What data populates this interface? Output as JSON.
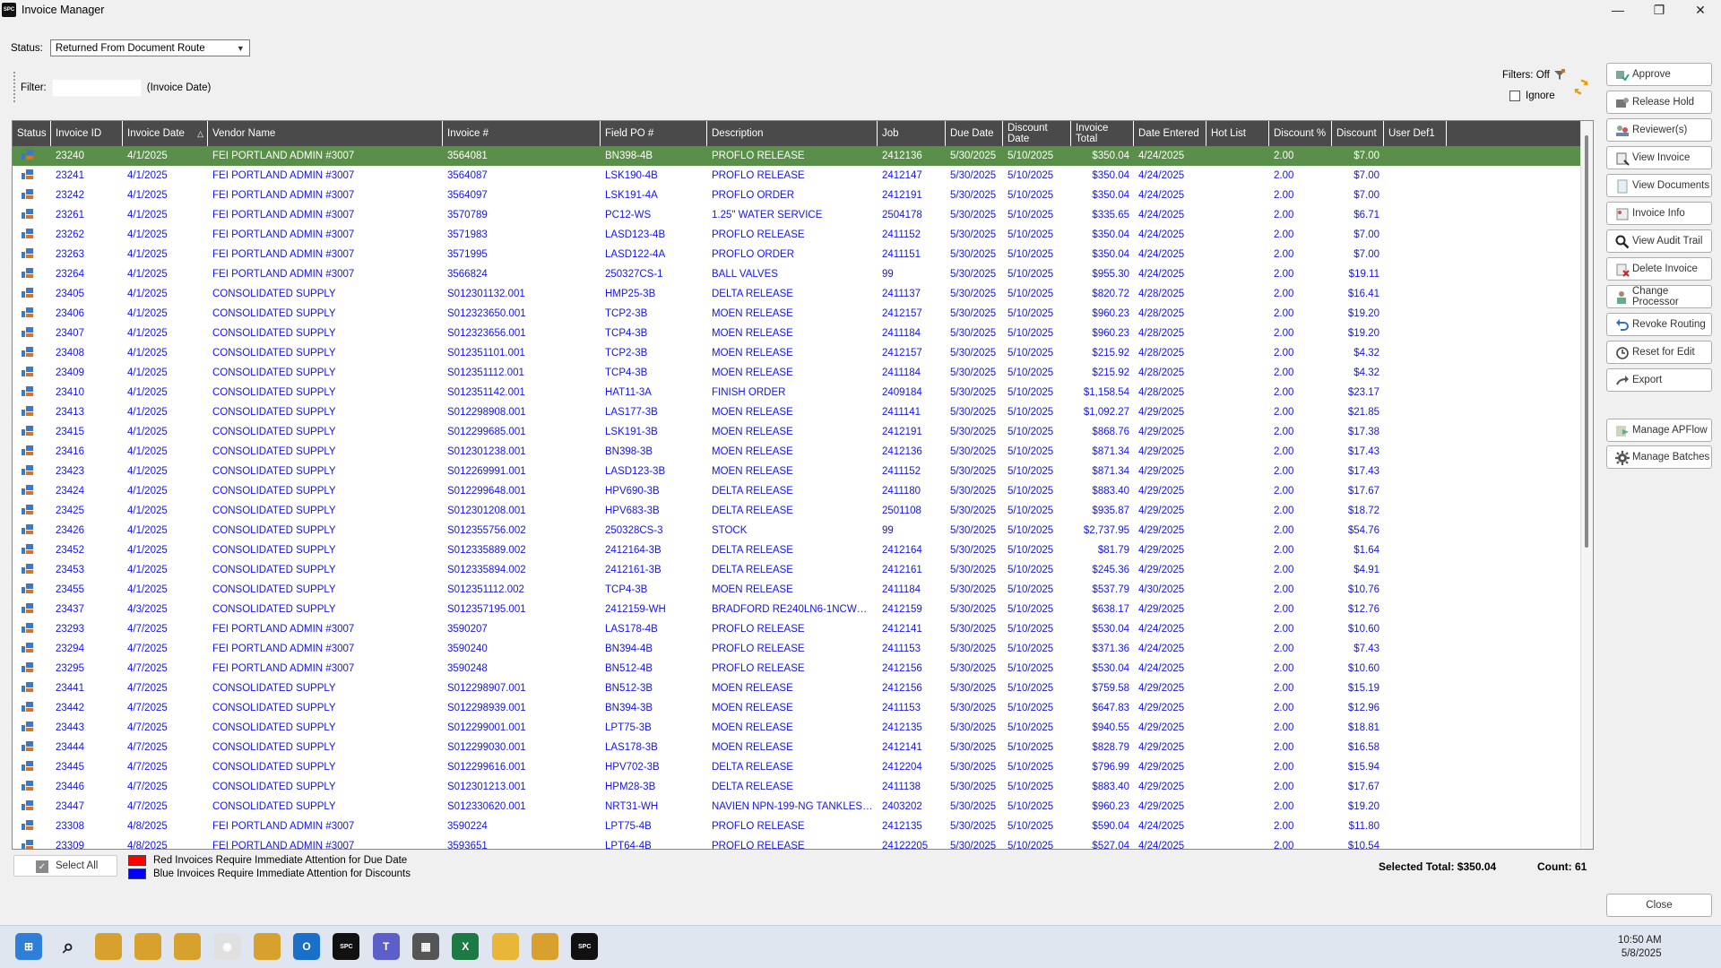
{
  "window": {
    "title": "Invoice Manager",
    "icon_text": "SPC",
    "controls": {
      "minimize": "—",
      "restore": "❐",
      "close": "✕"
    }
  },
  "toolbar": {
    "status_label": "Status:",
    "status_value": "Returned From Document Route",
    "filter_label": "Filter:",
    "filter_value": "",
    "filter_hint": "(Invoice Date)",
    "filters_off_label": "Filters: Off",
    "ignore_label": "Ignore"
  },
  "table": {
    "columns": [
      "Status",
      "Invoice ID",
      "Invoice Date",
      "Vendor Name",
      "Invoice #",
      "Field PO #",
      "Description",
      "Job",
      "Due Date",
      "Discount Date",
      "Invoice Total",
      "Date Entered",
      "Hot List",
      "Discount %",
      "Discount",
      "User Def1"
    ],
    "rows": [
      [
        "23240",
        "4/1/2025",
        "FEI PORTLAND ADMIN #3007",
        "3564081",
        "BN398-4B",
        "PROFLO RELEASE",
        "2412136",
        "5/30/2025",
        "5/10/2025",
        "$350.04",
        "4/24/2025",
        "",
        "2.00",
        "$7.00",
        ""
      ],
      [
        "23241",
        "4/1/2025",
        "FEI PORTLAND ADMIN #3007",
        "3564087",
        "LSK190-4B",
        "PROFLO RELEASE",
        "2412147",
        "5/30/2025",
        "5/10/2025",
        "$350.04",
        "4/24/2025",
        "",
        "2.00",
        "$7.00",
        ""
      ],
      [
        "23242",
        "4/1/2025",
        "FEI PORTLAND ADMIN #3007",
        "3564097",
        "LSK191-4A",
        "PROFLO ORDER",
        "2412191",
        "5/30/2025",
        "5/10/2025",
        "$350.04",
        "4/24/2025",
        "",
        "2.00",
        "$7.00",
        ""
      ],
      [
        "23261",
        "4/1/2025",
        "FEI PORTLAND ADMIN #3007",
        "3570789",
        "PC12-WS",
        "1.25\" WATER SERVICE",
        "2504178",
        "5/30/2025",
        "5/10/2025",
        "$335.65",
        "4/24/2025",
        "",
        "2.00",
        "$6.71",
        ""
      ],
      [
        "23262",
        "4/1/2025",
        "FEI PORTLAND ADMIN #3007",
        "3571983",
        "LASD123-4B",
        "PROFLO RELEASE",
        "2411152",
        "5/30/2025",
        "5/10/2025",
        "$350.04",
        "4/24/2025",
        "",
        "2.00",
        "$7.00",
        ""
      ],
      [
        "23263",
        "4/1/2025",
        "FEI PORTLAND ADMIN #3007",
        "3571995",
        "LASD122-4A",
        "PROFLO ORDER",
        "2411151",
        "5/30/2025",
        "5/10/2025",
        "$350.04",
        "4/24/2025",
        "",
        "2.00",
        "$7.00",
        ""
      ],
      [
        "23264",
        "4/1/2025",
        "FEI PORTLAND ADMIN #3007",
        "3566824",
        "250327CS-1",
        "BALL VALVES",
        "99",
        "5/30/2025",
        "5/10/2025",
        "$955.30",
        "4/24/2025",
        "",
        "2.00",
        "$19.11",
        ""
      ],
      [
        "23405",
        "4/1/2025",
        "CONSOLIDATED SUPPLY",
        "S012301132.001",
        "HMP25-3B",
        "DELTA RELEASE",
        "2411137",
        "5/30/2025",
        "5/10/2025",
        "$820.72",
        "4/28/2025",
        "",
        "2.00",
        "$16.41",
        ""
      ],
      [
        "23406",
        "4/1/2025",
        "CONSOLIDATED SUPPLY",
        "S012323650.001",
        "TCP2-3B",
        "MOEN RELEASE",
        "2412157",
        "5/30/2025",
        "5/10/2025",
        "$960.23",
        "4/28/2025",
        "",
        "2.00",
        "$19.20",
        ""
      ],
      [
        "23407",
        "4/1/2025",
        "CONSOLIDATED SUPPLY",
        "S012323656.001",
        "TCP4-3B",
        "MOEN RELEASE",
        "2411184",
        "5/30/2025",
        "5/10/2025",
        "$960.23",
        "4/28/2025",
        "",
        "2.00",
        "$19.20",
        ""
      ],
      [
        "23408",
        "4/1/2025",
        "CONSOLIDATED SUPPLY",
        "S012351101.001",
        "TCP2-3B",
        "MOEN RELEASE",
        "2412157",
        "5/30/2025",
        "5/10/2025",
        "$215.92",
        "4/28/2025",
        "",
        "2.00",
        "$4.32",
        ""
      ],
      [
        "23409",
        "4/1/2025",
        "CONSOLIDATED SUPPLY",
        "S012351112.001",
        "TCP4-3B",
        "MOEN RELEASE",
        "2411184",
        "5/30/2025",
        "5/10/2025",
        "$215.92",
        "4/28/2025",
        "",
        "2.00",
        "$4.32",
        ""
      ],
      [
        "23410",
        "4/1/2025",
        "CONSOLIDATED SUPPLY",
        "S012351142.001",
        "HAT11-3A",
        "FINISH ORDER",
        "2409184",
        "5/30/2025",
        "5/10/2025",
        "$1,158.54",
        "4/28/2025",
        "",
        "2.00",
        "$23.17",
        ""
      ],
      [
        "23413",
        "4/1/2025",
        "CONSOLIDATED SUPPLY",
        "S012298908.001",
        "LAS177-3B",
        "MOEN RELEASE",
        "2411141",
        "5/30/2025",
        "5/10/2025",
        "$1,092.27",
        "4/29/2025",
        "",
        "2.00",
        "$21.85",
        ""
      ],
      [
        "23415",
        "4/1/2025",
        "CONSOLIDATED SUPPLY",
        "S012299685.001",
        "LSK191-3B",
        "MOEN RELEASE",
        "2412191",
        "5/30/2025",
        "5/10/2025",
        "$868.76",
        "4/29/2025",
        "",
        "2.00",
        "$17.38",
        ""
      ],
      [
        "23416",
        "4/1/2025",
        "CONSOLIDATED SUPPLY",
        "S012301238.001",
        "BN398-3B",
        "MOEN RELEASE",
        "2412136",
        "5/30/2025",
        "5/10/2025",
        "$871.34",
        "4/29/2025",
        "",
        "2.00",
        "$17.43",
        ""
      ],
      [
        "23423",
        "4/1/2025",
        "CONSOLIDATED SUPPLY",
        "S012269991.001",
        "LASD123-3B",
        "MOEN RELEASE",
        "2411152",
        "5/30/2025",
        "5/10/2025",
        "$871.34",
        "4/29/2025",
        "",
        "2.00",
        "$17.43",
        ""
      ],
      [
        "23424",
        "4/1/2025",
        "CONSOLIDATED SUPPLY",
        "S012299648.001",
        "HPV690-3B",
        "DELTA RELEASE",
        "2411180",
        "5/30/2025",
        "5/10/2025",
        "$883.40",
        "4/29/2025",
        "",
        "2.00",
        "$17.67",
        ""
      ],
      [
        "23425",
        "4/1/2025",
        "CONSOLIDATED SUPPLY",
        "S012301208.001",
        "HPV683-3B",
        "DELTA RELEASE",
        "2501108",
        "5/30/2025",
        "5/10/2025",
        "$935.87",
        "4/29/2025",
        "",
        "2.00",
        "$18.72",
        ""
      ],
      [
        "23426",
        "4/1/2025",
        "CONSOLIDATED SUPPLY",
        "S012355756.002",
        "250328CS-3",
        "STOCK",
        "99",
        "5/30/2025",
        "5/10/2025",
        "$2,737.95",
        "4/29/2025",
        "",
        "2.00",
        "$54.76",
        ""
      ],
      [
        "23452",
        "4/1/2025",
        "CONSOLIDATED SUPPLY",
        "S012335889.002",
        "2412164-3B",
        "DELTA RELEASE",
        "2412164",
        "5/30/2025",
        "5/10/2025",
        "$81.79",
        "4/29/2025",
        "",
        "2.00",
        "$1.64",
        ""
      ],
      [
        "23453",
        "4/1/2025",
        "CONSOLIDATED SUPPLY",
        "S012335894.002",
        "2412161-3B",
        "DELTA RELEASE",
        "2412161",
        "5/30/2025",
        "5/10/2025",
        "$245.36",
        "4/29/2025",
        "",
        "2.00",
        "$4.91",
        ""
      ],
      [
        "23455",
        "4/1/2025",
        "CONSOLIDATED SUPPLY",
        "S012351112.002",
        "TCP4-3B",
        "MOEN RELEASE",
        "2411184",
        "5/30/2025",
        "5/10/2025",
        "$537.79",
        "4/30/2025",
        "",
        "2.00",
        "$10.76",
        ""
      ],
      [
        "23437",
        "4/3/2025",
        "CONSOLIDATED SUPPLY",
        "S012357195.001",
        "2412159-WH",
        "BRADFORD RE240LN6-1NCWW 3...",
        "2412159",
        "5/30/2025",
        "5/10/2025",
        "$638.17",
        "4/29/2025",
        "",
        "2.00",
        "$12.76",
        ""
      ],
      [
        "23293",
        "4/7/2025",
        "FEI PORTLAND ADMIN #3007",
        "3590207",
        "LAS178-4B",
        "PROFLO RELEASE",
        "2412141",
        "5/30/2025",
        "5/10/2025",
        "$530.04",
        "4/24/2025",
        "",
        "2.00",
        "$10.60",
        ""
      ],
      [
        "23294",
        "4/7/2025",
        "FEI PORTLAND ADMIN #3007",
        "3590240",
        "BN394-4B",
        "PROFLO RELEASE",
        "2411153",
        "5/30/2025",
        "5/10/2025",
        "$371.36",
        "4/24/2025",
        "",
        "2.00",
        "$7.43",
        ""
      ],
      [
        "23295",
        "4/7/2025",
        "FEI PORTLAND ADMIN #3007",
        "3590248",
        "BN512-4B",
        "PROFLO RELEASE",
        "2412156",
        "5/30/2025",
        "5/10/2025",
        "$530.04",
        "4/24/2025",
        "",
        "2.00",
        "$10.60",
        ""
      ],
      [
        "23441",
        "4/7/2025",
        "CONSOLIDATED SUPPLY",
        "S012298907.001",
        "BN512-3B",
        "MOEN RELEASE",
        "2412156",
        "5/30/2025",
        "5/10/2025",
        "$759.58",
        "4/29/2025",
        "",
        "2.00",
        "$15.19",
        ""
      ],
      [
        "23442",
        "4/7/2025",
        "CONSOLIDATED SUPPLY",
        "S012298939.001",
        "BN394-3B",
        "MOEN RELEASE",
        "2411153",
        "5/30/2025",
        "5/10/2025",
        "$647.83",
        "4/29/2025",
        "",
        "2.00",
        "$12.96",
        ""
      ],
      [
        "23443",
        "4/7/2025",
        "CONSOLIDATED SUPPLY",
        "S012299001.001",
        "LPT75-3B",
        "MOEN RELEASE",
        "2412135",
        "5/30/2025",
        "5/10/2025",
        "$940.55",
        "4/29/2025",
        "",
        "2.00",
        "$18.81",
        ""
      ],
      [
        "23444",
        "4/7/2025",
        "CONSOLIDATED SUPPLY",
        "S012299030.001",
        "LAS178-3B",
        "MOEN RELEASE",
        "2412141",
        "5/30/2025",
        "5/10/2025",
        "$828.79",
        "4/29/2025",
        "",
        "2.00",
        "$16.58",
        ""
      ],
      [
        "23445",
        "4/7/2025",
        "CONSOLIDATED SUPPLY",
        "S012299616.001",
        "HPV702-3B",
        "DELTA RELEASE",
        "2412204",
        "5/30/2025",
        "5/10/2025",
        "$796.99",
        "4/29/2025",
        "",
        "2.00",
        "$15.94",
        ""
      ],
      [
        "23446",
        "4/7/2025",
        "CONSOLIDATED SUPPLY",
        "S012301213.001",
        "HPM28-3B",
        "DELTA RELEASE",
        "2411138",
        "5/30/2025",
        "5/10/2025",
        "$883.40",
        "4/29/2025",
        "",
        "2.00",
        "$17.67",
        ""
      ],
      [
        "23447",
        "4/7/2025",
        "CONSOLIDATED SUPPLY",
        "S012330620.001",
        "NRT31-WH",
        "NAVIEN NPN-199-NG TANKLESS ...",
        "2403202",
        "5/30/2025",
        "5/10/2025",
        "$960.23",
        "4/29/2025",
        "",
        "2.00",
        "$19.20",
        ""
      ],
      [
        "23308",
        "4/8/2025",
        "FEI PORTLAND ADMIN #3007",
        "3590224",
        "LPT75-4B",
        "PROFLO RELEASE",
        "2412135",
        "5/30/2025",
        "5/10/2025",
        "$590.04",
        "4/24/2025",
        "",
        "2.00",
        "$11.80",
        ""
      ],
      [
        "23309",
        "4/8/2025",
        "FEI PORTLAND ADMIN #3007",
        "3593651",
        "LPT64-4B",
        "PROFLO RELEASE",
        "24122205",
        "5/30/2025",
        "5/10/2025",
        "$527.04",
        "4/24/2025",
        "",
        "2.00",
        "$10.54",
        ""
      ]
    ],
    "selected_row": 0
  },
  "side_buttons": [
    {
      "label": "Approve",
      "icon": "approve-icon"
    },
    {
      "label": "Release Hold",
      "icon": "release-hold-icon"
    },
    {
      "label": "Reviewer(s)",
      "icon": "reviewers-icon"
    },
    {
      "label": "View Invoice",
      "icon": "view-invoice-icon"
    },
    {
      "label": "View Documents",
      "icon": "view-documents-icon"
    },
    {
      "label": "Invoice Info",
      "icon": "invoice-info-icon"
    },
    {
      "label": "View Audit Trail",
      "icon": "search-icon"
    },
    {
      "label": "Delete Invoice",
      "icon": "delete-invoice-icon"
    },
    {
      "label": "Change Processor",
      "icon": "change-processor-icon"
    },
    {
      "label": "Revoke Routing",
      "icon": "undo-icon"
    },
    {
      "label": "Reset for Edit",
      "icon": "reset-icon"
    },
    {
      "label": "Export",
      "icon": "export-arrow-icon"
    },
    {
      "label": "Manage APFlow",
      "icon": "manage-apflow-icon"
    },
    {
      "label": "Manage Batches",
      "icon": "gear-icon"
    }
  ],
  "footer": {
    "select_all_label": "Select All",
    "legend_red": "Red Invoices Require Immediate Attention for Due Date",
    "legend_blue": "Blue Invoices Require Immediate Attention for Discounts",
    "legend_red_color": "#ff0000",
    "legend_blue_color": "#0000ff",
    "selected_total": "Selected Total: $350.04",
    "count": "Count: 61",
    "close_label": "Close"
  },
  "taskbar": {
    "time": "10:50 AM",
    "date": "5/8/2025",
    "apps": [
      "start-icon",
      "search-icon",
      "app-icon",
      "app-icon",
      "app-icon",
      "chrome-icon",
      "app-icon",
      "outlook-icon",
      "spc-icon",
      "teams-icon",
      "calculator-icon",
      "excel-icon",
      "folder-icon",
      "app-icon",
      "spc-icon"
    ]
  },
  "colors": {
    "header_bg": "#4a4a4a",
    "selected_row_bg": "#5a8f4a",
    "row_text": "#1515e8"
  }
}
